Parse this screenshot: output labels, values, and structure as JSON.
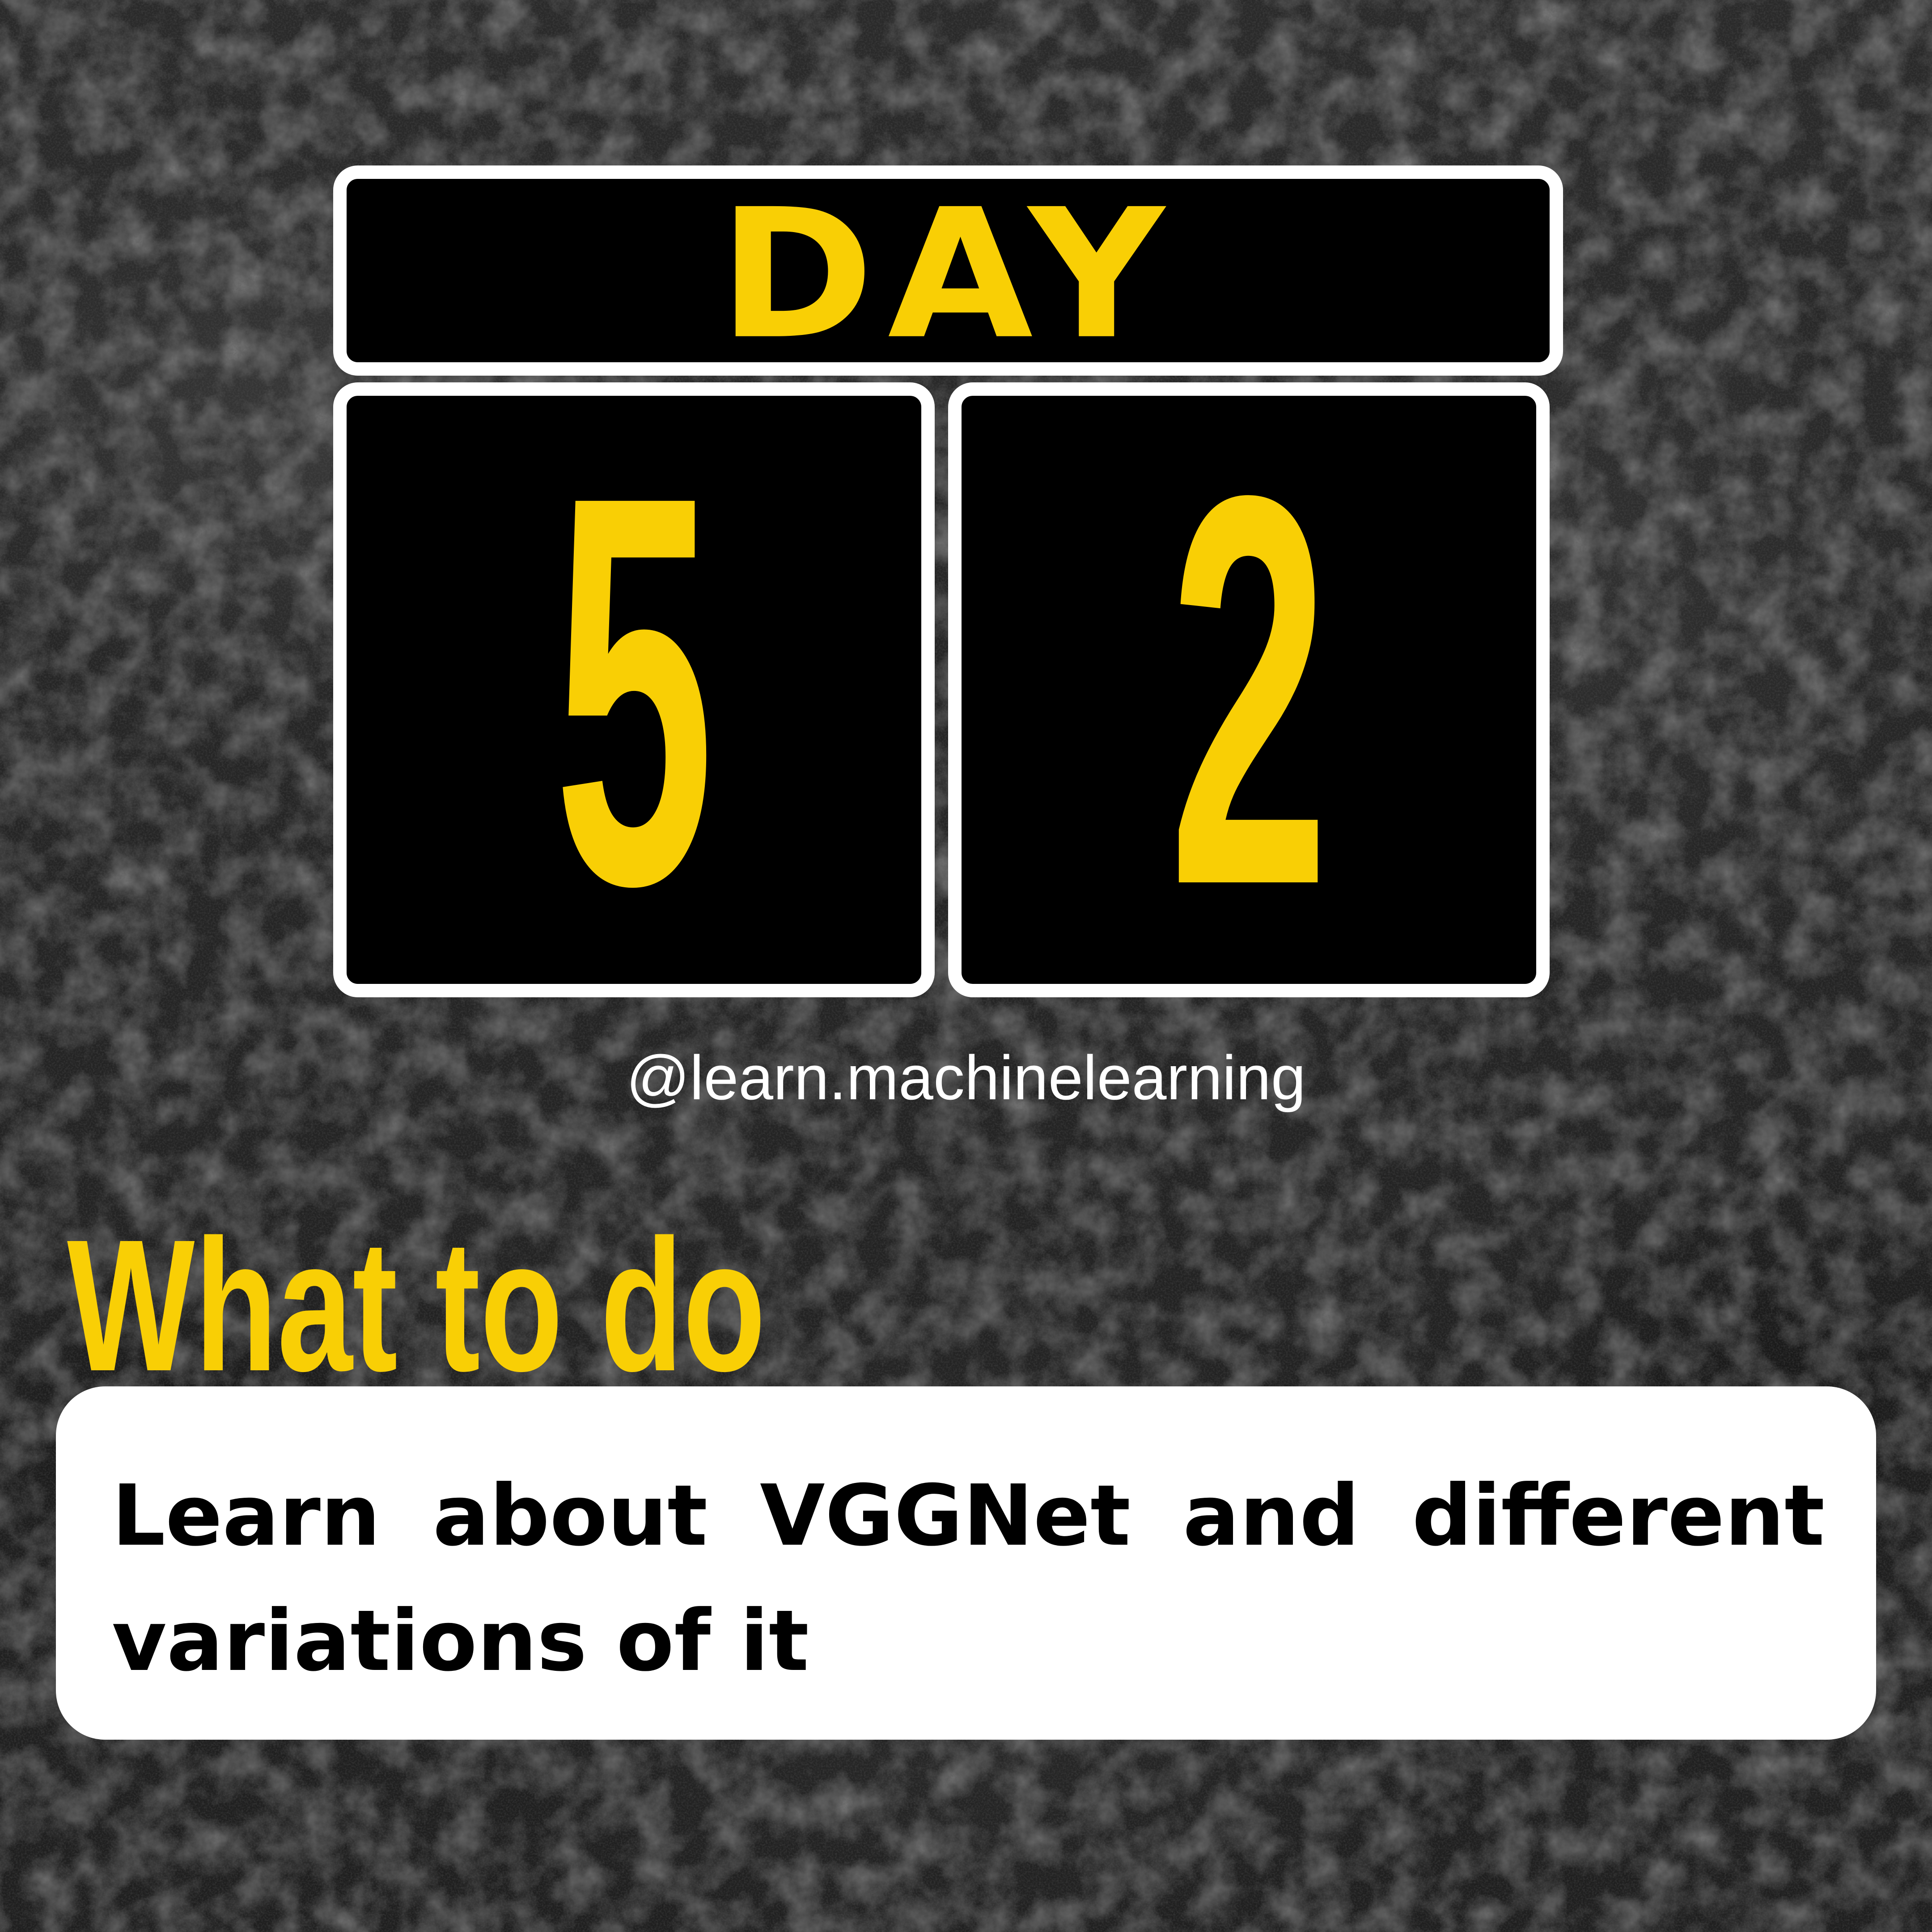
{
  "header": {
    "day_label": "DAY",
    "digit_1": "5",
    "digit_2": "2"
  },
  "handle": "@learn.machinelearning",
  "section": {
    "heading": "What to do",
    "body": "Learn about VGGNet and different variations of it"
  },
  "colors": {
    "accent_yellow": "#f9cf05",
    "panel_black": "#000000",
    "panel_border": "#ffffff",
    "card_bg": "#ffffff",
    "background": "#252525"
  }
}
